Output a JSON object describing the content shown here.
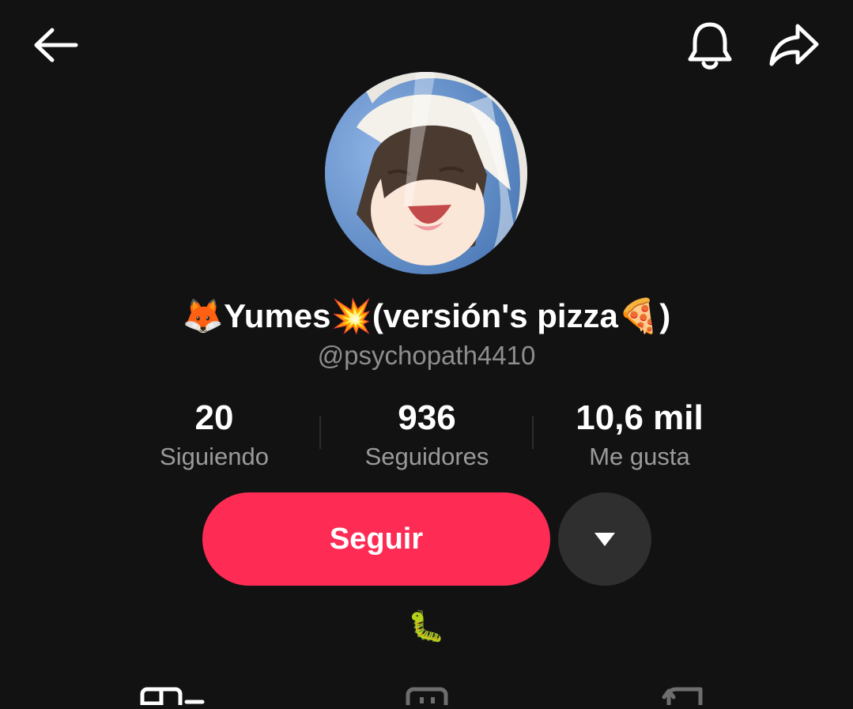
{
  "header": {
    "back_icon": "arrow-left-icon",
    "notify_icon": "bell-icon",
    "share_icon": "share-arrow-icon"
  },
  "profile": {
    "display_name": "🦊Yumes💥(versión's pizza🍕)",
    "username": "@psychopath4410",
    "bio": "🐛"
  },
  "stats": [
    {
      "value": "20",
      "label": "Siguiendo"
    },
    {
      "value": "936",
      "label": "Seguidores"
    },
    {
      "value": "10,6 mil",
      "label": "Me gusta"
    }
  ],
  "actions": {
    "follow_label": "Seguir",
    "more_icon": "caret-down-icon"
  },
  "tabs": [
    {
      "icon": "videos-grid-icon"
    },
    {
      "icon": "lock-icon"
    },
    {
      "icon": "repost-icon"
    }
  ],
  "colors": {
    "background": "#121212",
    "accent": "#fe2c55",
    "secondary_text": "#8e8e8e"
  }
}
